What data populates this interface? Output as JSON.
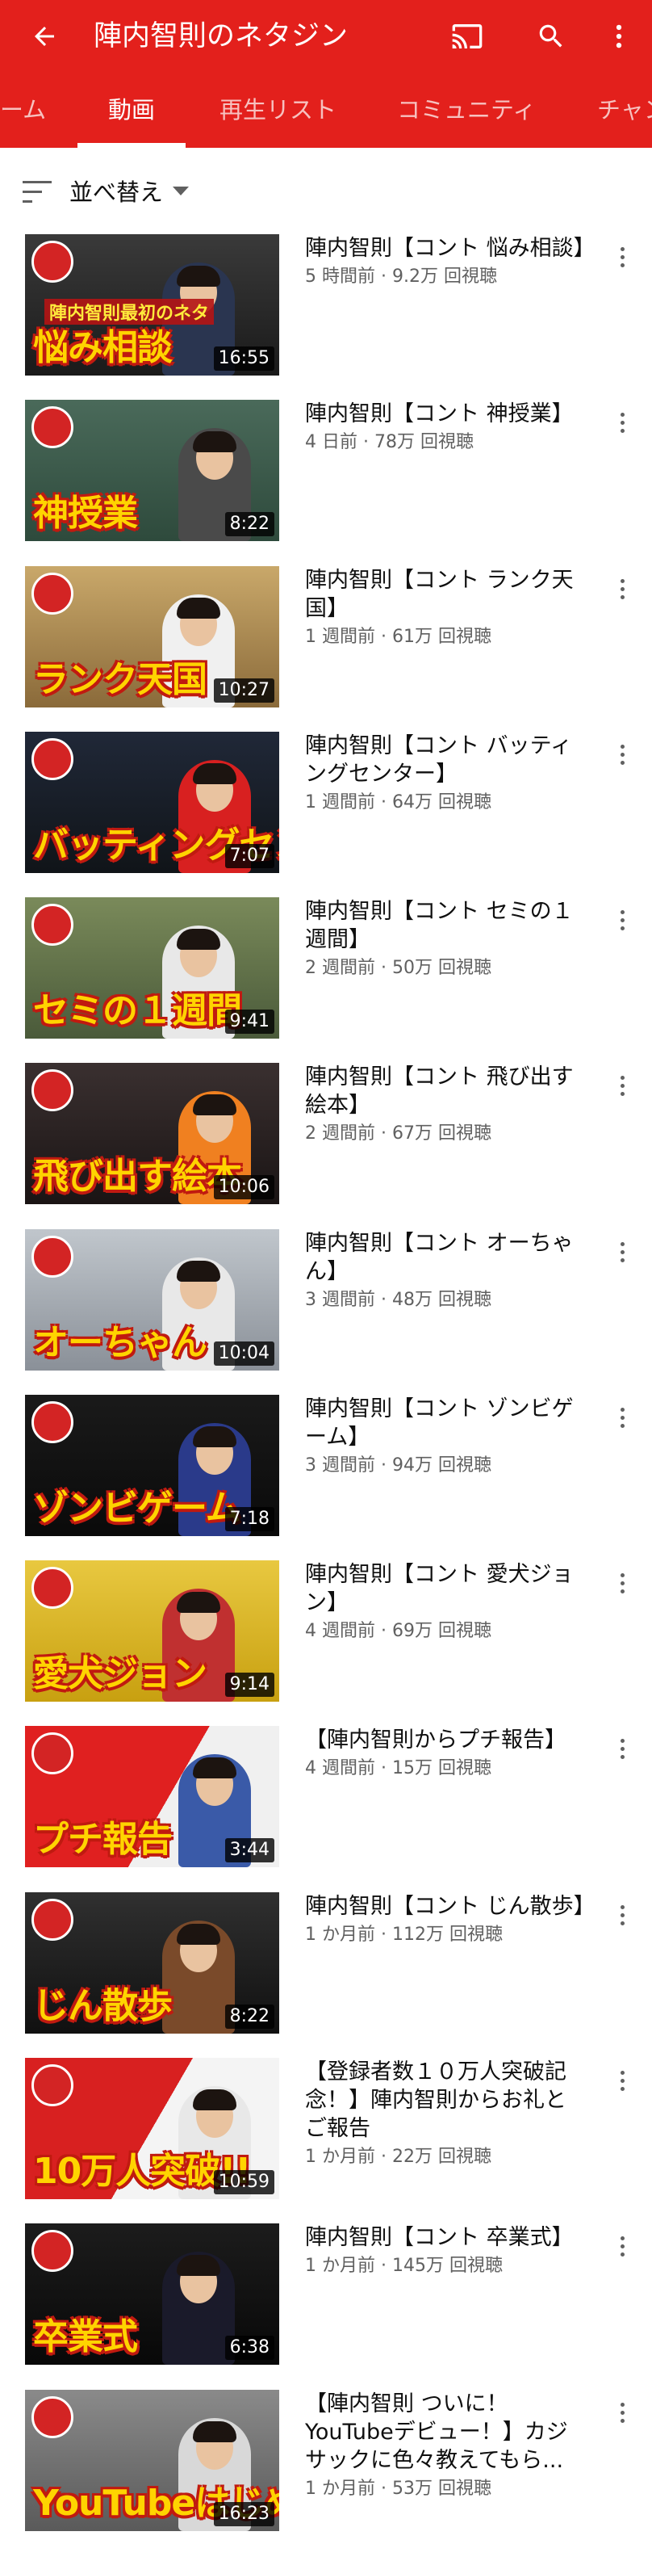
{
  "appbar": {
    "title": "陣内智則のネタジン",
    "bg_color": "#e3201c",
    "icons": [
      "back-arrow-icon",
      "cast-icon",
      "search-icon",
      "more-vert-icon"
    ]
  },
  "tabs": {
    "items": [
      "ーム",
      "動画",
      "再生リスト",
      "コミュニティ",
      "チャン"
    ],
    "active": "動画"
  },
  "sort": {
    "label": "並べ替え",
    "icon": "sort-icon"
  },
  "videos": [
    {
      "title": "陣内智則【コント 悩み相談】",
      "views_time": "5 時間前 · 9.2万 回視聴",
      "duration": "16:55",
      "thumb_caption": "悩み相談",
      "thumb_subcaption": "陣内智則最初のネタ"
    },
    {
      "title": "陣内智則【コント 神授業】",
      "views_time": "4 日前 · 78万 回視聴",
      "duration": "8:22",
      "thumb_caption": "神授業"
    },
    {
      "title": "陣内智則【コント ランク天国】",
      "views_time": "1 週間前 · 61万 回視聴",
      "duration": "10:27",
      "thumb_caption": "ランク天国"
    },
    {
      "title": "陣内智則【コント バッティングセンター】",
      "views_time": "1 週間前 · 64万 回視聴",
      "duration": "7:07",
      "thumb_caption": "バッティングセン"
    },
    {
      "title": "陣内智則【コント セミの１週間】",
      "views_time": "2 週間前 · 50万 回視聴",
      "duration": "9:41",
      "thumb_caption": "セミの１週間"
    },
    {
      "title": "陣内智則【コント 飛び出す絵本】",
      "views_time": "2 週間前 · 67万 回視聴",
      "duration": "10:06",
      "thumb_caption": "飛び出す絵本"
    },
    {
      "title": "陣内智則【コント オーちゃん】",
      "views_time": "3 週間前 · 48万 回視聴",
      "duration": "10:04",
      "thumb_caption": "オーちゃん"
    },
    {
      "title": "陣内智則【コント ゾンビゲーム】",
      "views_time": "3 週間前 · 94万 回視聴",
      "duration": "7:18",
      "thumb_caption": "ゾンビゲーム"
    },
    {
      "title": "陣内智則【コント 愛犬ジョン】",
      "views_time": "4 週間前 · 69万 回視聴",
      "duration": "9:14",
      "thumb_caption": "愛犬ジョン"
    },
    {
      "title": "【陣内智則からプチ報告】",
      "views_time": "4 週間前 · 15万 回視聴",
      "duration": "3:44",
      "thumb_caption": "プチ報告"
    },
    {
      "title": "陣内智則【コント じん散歩】",
      "views_time": "1 か月前 · 112万 回視聴",
      "duration": "8:22",
      "thumb_caption": "じん散歩"
    },
    {
      "title": "【登録者数１０万人突破記念！】陣内智則からお礼とご報告",
      "views_time": "1 か月前 · 22万 回視聴",
      "duration": "10:59",
      "thumb_caption": "10万人突破!!"
    },
    {
      "title": "陣内智則【コント 卒業式】",
      "views_time": "1 か月前 · 145万 回視聴",
      "duration": "6:38",
      "thumb_caption": "卒業式"
    },
    {
      "title": "【陣内智則 ついに！YouTubeデビュー！】カジサックに色々教えてもら...",
      "views_time": "1 か月前 · 53万 回視聴",
      "duration": "16:23",
      "thumb_caption": "YouTubeはじめまし"
    }
  ]
}
